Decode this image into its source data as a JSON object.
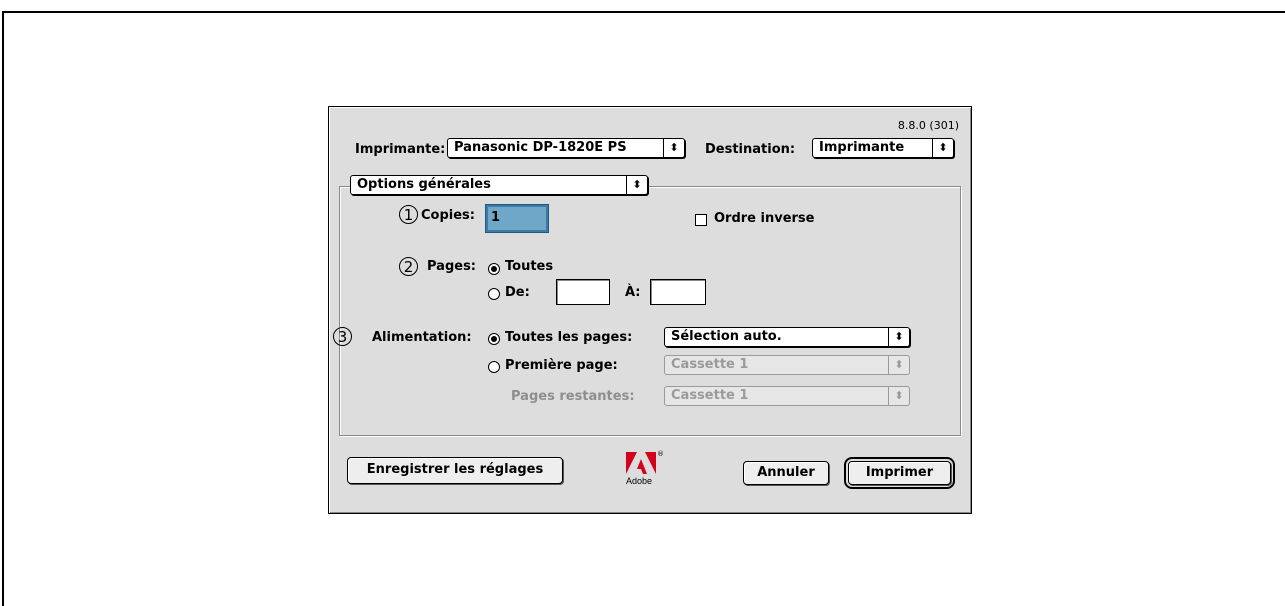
{
  "version": "8.8.0 (301)",
  "printer": {
    "label": "Imprimante:",
    "value": "Panasonic DP-1820E PS"
  },
  "destination": {
    "label": "Destination:",
    "value": "Imprimante"
  },
  "panel_menu": {
    "value": "Options générales"
  },
  "callouts": [
    "1",
    "2",
    "3"
  ],
  "copies": {
    "label": "Copies:",
    "value": "1"
  },
  "reverse_order": {
    "label": "Ordre inverse",
    "checked": false
  },
  "pages": {
    "label": "Pages:",
    "all_label": "Toutes",
    "from_label": "De:",
    "to_label": "À:",
    "selected": "all"
  },
  "paper_source": {
    "label": "Alimentation:",
    "all_pages_label": "Toutes les pages:",
    "all_pages_value": "Sélection auto.",
    "first_page_label": "Première page:",
    "first_page_value": "Cassette 1",
    "remaining_label": "Pages restantes:",
    "remaining_value": "Cassette 1",
    "selected": "all"
  },
  "buttons": {
    "save_settings": "Enregistrer les réglages",
    "cancel": "Annuler",
    "print": "Imprimer"
  },
  "logo": {
    "text": "Adobe",
    "color": "#d4001e"
  },
  "icons": {
    "popup_arrows": "updown-arrows-icon"
  },
  "colors": {
    "dialog_bg": "#dddddd",
    "focus_ring": "#3d7aa6"
  }
}
